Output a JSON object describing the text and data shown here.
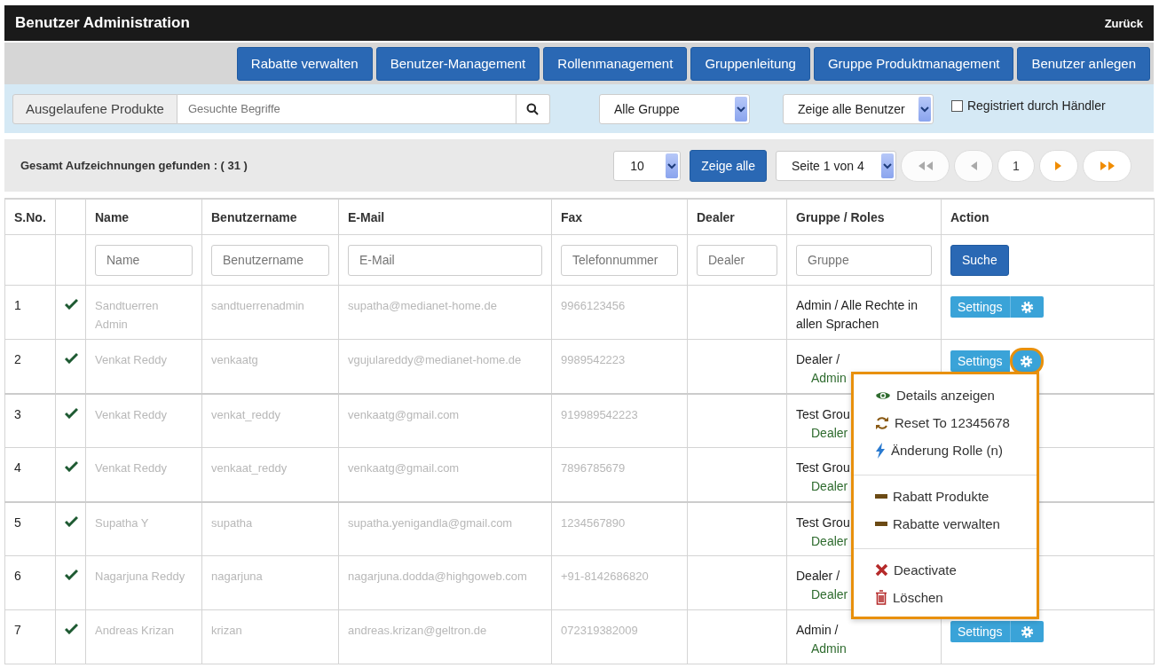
{
  "header": {
    "title": "Benutzer Administration",
    "back_link": "Zurück"
  },
  "nav_buttons": [
    "Rabatte verwalten",
    "Benutzer-Management",
    "Rollenmanagement",
    "Gruppenleitung",
    "Gruppe Produktmanagement",
    "Benutzer anlegen"
  ],
  "filter_bar": {
    "search_addon": "Ausgelaufene Produkte",
    "search_placeholder": "Gesuchte Begriffe",
    "group_select": "Alle Gruppe",
    "user_select": "Zeige alle Benutzer",
    "dealer_checkbox": {
      "label": "Registriert durch Händler",
      "checked": false
    }
  },
  "pager": {
    "total": "Gesamt Aufzeichnungen gefunden : ( 31 )",
    "page_size": "10",
    "show_all": "Zeige alle",
    "page_select": "Seite 1 von 4",
    "buttons": [
      {
        "kind": "first",
        "disabled": true
      },
      {
        "kind": "prev",
        "disabled": true
      },
      {
        "kind": "page",
        "label": "1",
        "disabled": false
      },
      {
        "kind": "next",
        "disabled": false
      },
      {
        "kind": "last",
        "disabled": false
      }
    ]
  },
  "table": {
    "columns": [
      "S.No.",
      "Name",
      "Benutzername",
      "E-Mail",
      "Fax",
      "Dealer",
      "Gruppe / Roles",
      "Action"
    ],
    "filters": [
      {
        "placeholder": "Name"
      },
      {
        "placeholder": "Benutzername"
      },
      {
        "placeholder": "E-Mail"
      },
      {
        "placeholder": "Telefonnummer"
      },
      {
        "placeholder": "Dealer"
      },
      {
        "placeholder": "Gruppe"
      }
    ],
    "search_button": "Suche",
    "rows": [
      {
        "sno": "1",
        "active": true,
        "name": "Sandtuerren Admin",
        "username": "sandtuerrenadmin",
        "email": "supatha@medianet-home.de",
        "fax": "9966123456",
        "group": "Admin  /  Alle Rechte in allen Sprachen",
        "action": "Settings",
        "menu_open": false
      },
      {
        "sno": "2",
        "active": true,
        "name": "Venkat Reddy",
        "username": "venkaatg",
        "email": "vgujulareddy@medianet-home.de",
        "fax": "9989542223",
        "group": "Dealer  /",
        "role": "Admin",
        "action": "Settings",
        "menu_open": true
      },
      {
        "sno": "3",
        "active": true,
        "name": "Venkat Reddy",
        "username": "venkat_reddy",
        "email": "venkaatg@gmail.com",
        "fax": "919989542223",
        "group": "Test Grou",
        "role": "Dealer"
      },
      {
        "sno": "4",
        "active": true,
        "name": "Venkat Reddy",
        "username": "venkaat_reddy",
        "email": "venkaatg@gmail.com",
        "fax": "7896785679",
        "group": "Test Grou",
        "role": "Dealer"
      },
      {
        "sno": "5",
        "active": true,
        "name": "Supatha Y",
        "username": "supatha",
        "email": "supatha.yenigandla@gmail.com",
        "fax": "1234567890",
        "group": "Test Grou",
        "role": "Dealer"
      },
      {
        "sno": "6",
        "active": true,
        "name": "Nagarjuna Reddy",
        "username": "nagarjuna",
        "email": "nagarjuna.dodda@highgoweb.com",
        "fax": "+91-8142686820",
        "group": "Dealer  /",
        "role": "Dealer"
      },
      {
        "sno": "7",
        "active": true,
        "name": "Andreas Krizan",
        "username": "krizan",
        "email": "andreas.krizan@geltron.de",
        "fax": "072319382009",
        "group": "Admin  /",
        "role": "Admin",
        "action": "Settings",
        "menu_open": false
      }
    ]
  },
  "menu": {
    "groups": [
      [
        {
          "kind": "view",
          "label": "Details anzeigen"
        },
        {
          "kind": "reset",
          "label": "Reset To 12345678"
        },
        {
          "kind": "role",
          "label": "Änderung Rolle (n)"
        }
      ],
      [
        {
          "kind": "discount",
          "label": "Rabatt Produkte"
        },
        {
          "kind": "discount",
          "label": "Rabatte verwalten"
        }
      ],
      [
        {
          "kind": "deactivate",
          "label": "Deactivate"
        },
        {
          "kind": "delete",
          "label": "Löschen"
        }
      ]
    ]
  }
}
